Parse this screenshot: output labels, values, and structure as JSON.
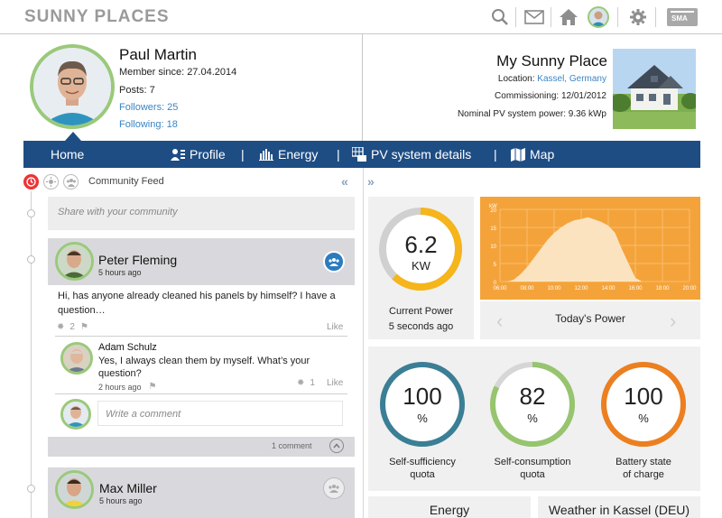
{
  "header": {
    "brand": "SUNNY PLACES",
    "icons": [
      "search-icon",
      "mail-icon",
      "home-icon",
      "avatar",
      "gear-icon",
      "sma-logo"
    ]
  },
  "profile": {
    "name": "Paul Martin",
    "member_since": "Member since: 27.04.2014",
    "posts": "Posts: 7",
    "followers": "Followers: 25",
    "following": "Following: 18"
  },
  "place": {
    "title": "My Sunny Place",
    "location_label": "Location:",
    "location_value": "Kassel, Germany",
    "commissioning": "Commissioning: 12/01/2012",
    "nominal_power": "Nominal PV system power:  9.36 kWp"
  },
  "nav": {
    "home": "Home",
    "profile": "Profile",
    "energy": "Energy",
    "pv": "PV system details",
    "map": "Map",
    "sep": "|"
  },
  "feed": {
    "title": "Community Feed",
    "share_placeholder": "Share with your community",
    "post1": {
      "author": "Peter Fleming",
      "time": "5 hours ago",
      "text": "Hi, has anyone already cleaned his panels by himself? I have a question…",
      "likes_count": "2",
      "like_label": "Like"
    },
    "reply1": {
      "author": "Adam Schulz",
      "text": "Yes, I always clean them by myself. What’s your question?",
      "time": "2 hours ago",
      "likes_count": "1",
      "like_label": "Like"
    },
    "comment_placeholder": "Write a comment",
    "comments_count": "1 comment",
    "post2": {
      "author": "Max Miller",
      "time": "5 hours ago"
    }
  },
  "power": {
    "value": "6.2",
    "unit": "KW",
    "label": "Current Power",
    "updated": "5 seconds ago",
    "fill_fraction": 0.62
  },
  "chart_data": {
    "type": "area",
    "title": "",
    "ylabel": "kW",
    "xlabel": "",
    "ylim": [
      0,
      20
    ],
    "yticks": [
      "0",
      "5",
      "10",
      "15",
      "20"
    ],
    "xticks": [
      "06:00",
      "08:00",
      "10:00",
      "12:00",
      "14:00",
      "16:00",
      "18:00",
      "20:00"
    ],
    "series": [
      {
        "x": [
          6,
          6.5,
          7,
          7.5,
          8,
          8.5,
          9,
          9.5,
          10,
          10.5,
          11,
          11.5,
          12,
          12.5,
          13,
          13.5,
          14,
          14.5,
          15,
          15.5,
          16,
          16.5
        ],
        "y": [
          0,
          0,
          0.5,
          2,
          4,
          6.5,
          9,
          11.5,
          13.5,
          15,
          16.2,
          17,
          17.3,
          17.8,
          17.2,
          16.5,
          15.5,
          13.5,
          9,
          5,
          1,
          0
        ]
      }
    ],
    "grid": true,
    "caption": "Today's Power",
    "colors": {
      "background": "#f4a33a",
      "fill": "#fbe3c0",
      "grid": "#f8c47e"
    }
  },
  "kpis": [
    {
      "value": "100",
      "unit": "%",
      "label_line1": "Self-sufficiency",
      "label_line2": "quota",
      "color": "#3a7f95",
      "fraction": 1.0
    },
    {
      "value": "82",
      "unit": "%",
      "label_line1": "Self-consumption",
      "label_line2": "quota",
      "color": "#97c46e",
      "fraction": 0.82
    },
    {
      "value": "100",
      "unit": "%",
      "label_line1": "Battery state",
      "label_line2": "of charge",
      "color": "#ec7f1f",
      "fraction": 1.0
    }
  ],
  "bottom_tabs": {
    "energy": "Energy",
    "weather": "Weather in Kassel (DEU)"
  },
  "colors": {
    "nav": "#1e4d84",
    "gauge": "#f5b51b",
    "avatar_ring": "#9ac97a",
    "link": "#3a85c4"
  }
}
